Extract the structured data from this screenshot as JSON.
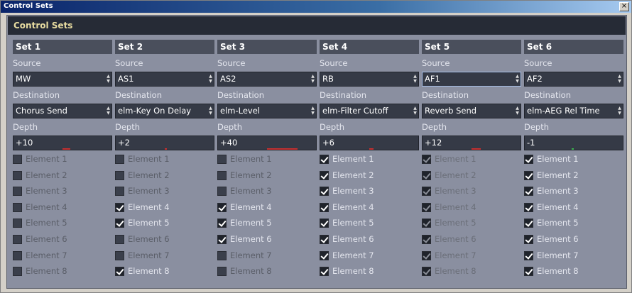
{
  "window": {
    "title": "Control Sets",
    "close": "×"
  },
  "panel": {
    "title": "Control Sets"
  },
  "labels": {
    "source": "Source",
    "destination": "Destination",
    "depth": "Depth"
  },
  "element_labels": [
    "Element 1",
    "Element 2",
    "Element 3",
    "Element 4",
    "Element 5",
    "Element 6",
    "Element 7",
    "Element 8"
  ],
  "sets": [
    {
      "name": "Set 1",
      "source": "MW",
      "destination": "Chorus Send",
      "depth": "+10",
      "depth_value": 10,
      "elements": [
        false,
        false,
        false,
        false,
        false,
        false,
        false,
        false
      ],
      "disabled": false
    },
    {
      "name": "Set 2",
      "source": "AS1",
      "destination": "elm-Key On Delay",
      "depth": "+2",
      "depth_value": 2,
      "elements": [
        false,
        false,
        false,
        true,
        true,
        false,
        false,
        true
      ],
      "disabled": false
    },
    {
      "name": "Set 3",
      "source": "AS2",
      "destination": "elm-Level",
      "depth": "+40",
      "depth_value": 40,
      "elements": [
        false,
        false,
        false,
        true,
        true,
        true,
        false,
        false
      ],
      "disabled": false
    },
    {
      "name": "Set 4",
      "source": "RB",
      "destination": "elm-Filter Cutoff",
      "depth": "+6",
      "depth_value": 6,
      "elements": [
        true,
        true,
        true,
        true,
        true,
        true,
        true,
        true
      ],
      "disabled": false
    },
    {
      "name": "Set 5",
      "source": "AF1",
      "destination": "Reverb Send",
      "depth": "+12",
      "depth_value": 12,
      "elements": [
        true,
        true,
        true,
        true,
        true,
        true,
        true,
        true
      ],
      "disabled": true
    },
    {
      "name": "Set 6",
      "source": "AF2",
      "destination": "elm-AEG Rel Time",
      "depth": "-1",
      "depth_value": -1,
      "elements": [
        true,
        true,
        true,
        true,
        true,
        true,
        true,
        true
      ],
      "disabled": false
    }
  ],
  "colors": {
    "panel": "#8a8fa0",
    "header": "#262b36",
    "field": "#353a46",
    "depth_bar": "#c83030",
    "depth_bar_negative": "#3cb050"
  }
}
